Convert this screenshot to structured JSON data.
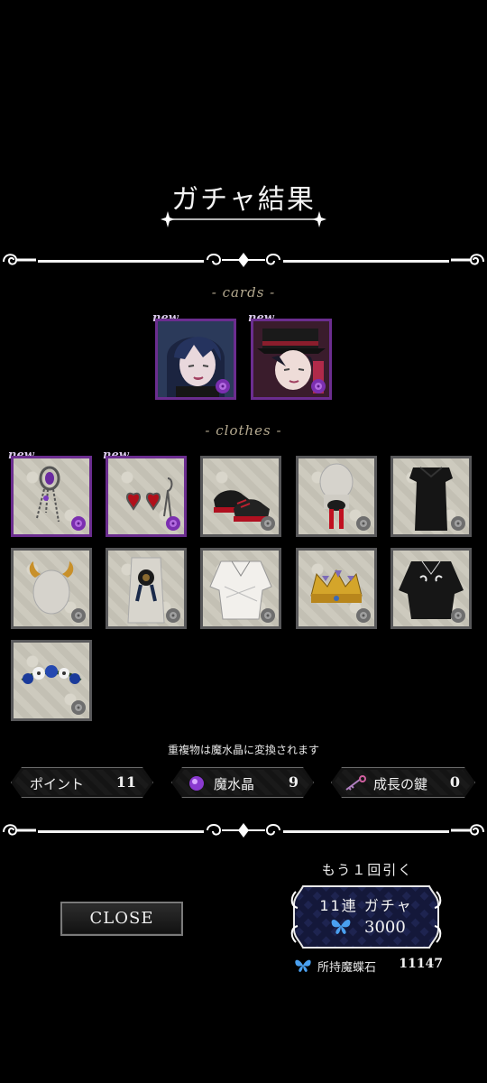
{
  "screen": {
    "title": "ガチャ結果",
    "cards_label": "- cards -",
    "clothes_label": "- clothes -",
    "new_tag": "new",
    "notice": "重複物は魔水晶に変換されます"
  },
  "cards": [
    {
      "name": "dark-haired character card",
      "is_new": true
    },
    {
      "name": "red-haired character card with hat",
      "is_new": true
    }
  ],
  "clothes": [
    {
      "icon": "jeweled-chain-accessory",
      "is_new": true
    },
    {
      "icon": "heart-earrings",
      "is_new": true
    },
    {
      "icon": "red-black-platform-shoes",
      "is_new": false
    },
    {
      "icon": "red-tassel-hair-ornament",
      "is_new": false
    },
    {
      "icon": "black-dress",
      "is_new": false
    },
    {
      "icon": "gold-horns",
      "is_new": false
    },
    {
      "icon": "rosette-brooch",
      "is_new": false
    },
    {
      "icon": "white-wrap-shirt",
      "is_new": false
    },
    {
      "icon": "gold-jeweled-crown",
      "is_new": false
    },
    {
      "icon": "black-embroidered-shirt",
      "is_new": false
    },
    {
      "icon": "blue-flower-crown",
      "is_new": false
    }
  ],
  "resources": {
    "points_label": "ポイント",
    "points_value": "11",
    "crystal_label": "魔水晶",
    "crystal_value": "9",
    "key_label": "成長の鍵",
    "key_value": "0"
  },
  "actions": {
    "close_label": "CLOSE",
    "again_label": "もう１回引く",
    "gacha_label": "11連 ガチャ",
    "gacha_cost": "3000",
    "owned_label": "所持魔蝶石",
    "owned_value": "11147"
  },
  "colors": {
    "background": "#000000",
    "new_frame": "#6b2d8f",
    "normal_frame": "#58585a",
    "section_label": "#b4a98f"
  }
}
